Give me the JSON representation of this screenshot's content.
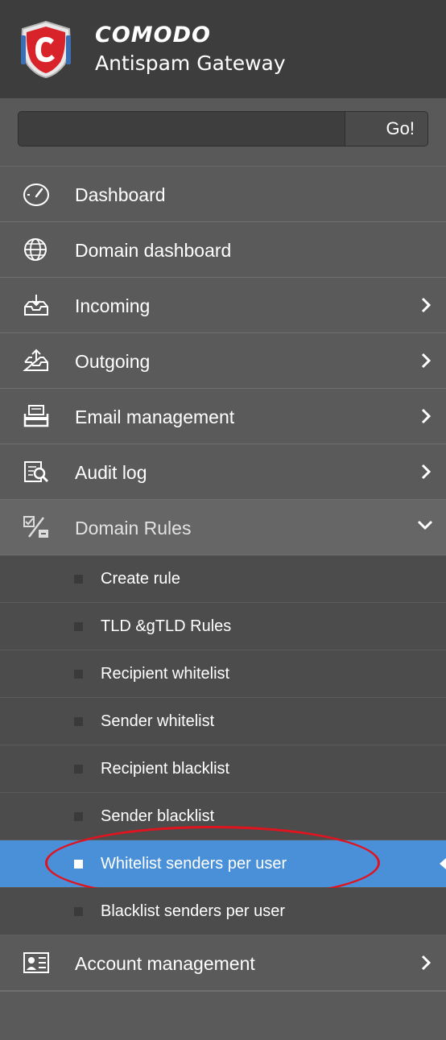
{
  "brand": {
    "name": "COMODO",
    "subtitle": "Antispam Gateway",
    "logo_icon": "comodo-shield-icon",
    "logo_color": "#d8232a"
  },
  "search": {
    "placeholder": "",
    "value": "",
    "button_label": "Go!"
  },
  "menu": {
    "items": [
      {
        "label": "Dashboard",
        "icon": "speedometer-icon",
        "chevron": "none"
      },
      {
        "label": "Domain dashboard",
        "icon": "globe-icon",
        "chevron": "none"
      },
      {
        "label": "Incoming",
        "icon": "inbox-download-icon",
        "chevron": "right"
      },
      {
        "label": "Outgoing",
        "icon": "outbox-upload-icon",
        "chevron": "right"
      },
      {
        "label": "Email management",
        "icon": "mail-tray-icon",
        "chevron": "right"
      },
      {
        "label": "Audit log",
        "icon": "audit-search-icon",
        "chevron": "right"
      },
      {
        "label": "Domain Rules",
        "icon": "rules-toggle-icon",
        "chevron": "down",
        "expanded": true
      }
    ],
    "submenu": [
      {
        "label": "Create rule"
      },
      {
        "label": "TLD &gTLD Rules"
      },
      {
        "label": "Recipient whitelist"
      },
      {
        "label": "Sender whitelist"
      },
      {
        "label": "Recipient blacklist"
      },
      {
        "label": "Sender blacklist"
      },
      {
        "label": "Whitelist senders per user",
        "active": true
      },
      {
        "label": "Blacklist senders per user"
      }
    ],
    "after": [
      {
        "label": "Account management",
        "icon": "account-card-icon",
        "chevron": "right"
      }
    ]
  },
  "colors": {
    "sidebar_bg": "#5a5a5a",
    "header_bg": "#3d3d3d",
    "submenu_bg": "#4c4c4c",
    "active_bg": "#4a90d9",
    "annotation_red": "#e0141e"
  }
}
